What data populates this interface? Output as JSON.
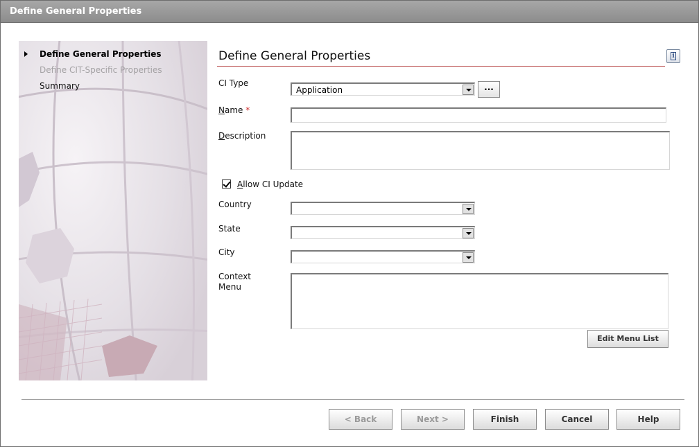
{
  "window": {
    "title": "Define General Properties"
  },
  "steps": [
    {
      "label": "Define General Properties",
      "state": "current"
    },
    {
      "label": "Define CIT-Specific Properties",
      "state": "disabled"
    },
    {
      "label": "Summary",
      "state": "normal"
    }
  ],
  "page": {
    "heading": "Define General Properties",
    "info_icon": "info-icon"
  },
  "form": {
    "ci_type": {
      "label": "CI Type",
      "value": "Application",
      "browse_label": "..."
    },
    "name": {
      "label_mnemonic": "N",
      "label_rest": "ame",
      "required_mark": "*",
      "value": ""
    },
    "description": {
      "label_mnemonic": "D",
      "label_rest": "escription",
      "value": ""
    },
    "allow_update": {
      "label_mnemonic": "A",
      "label_rest": "llow CI Update",
      "checked": true
    },
    "country": {
      "label": "Country",
      "value": ""
    },
    "state": {
      "label": "State",
      "value": ""
    },
    "city": {
      "label": "City",
      "value": ""
    },
    "context_menu": {
      "label_line1": "Context",
      "label_line2": "Menu",
      "value": "",
      "edit_label": "Edit Menu List"
    }
  },
  "buttons": {
    "back": "< Back",
    "next": "Next >",
    "finish": "Finish",
    "cancel": "Cancel",
    "help": "Help"
  },
  "colors": {
    "accent_line": "#b23a3a",
    "required": "#cc2222",
    "titlebar": "#9a9a9a"
  }
}
